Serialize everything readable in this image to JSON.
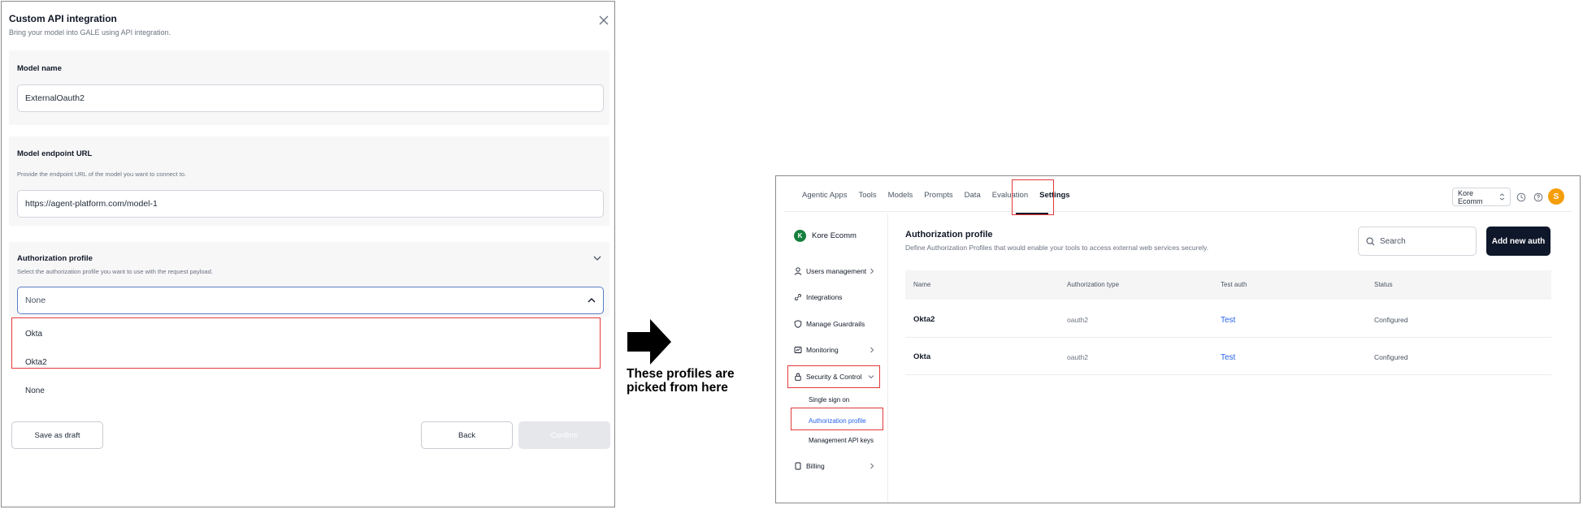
{
  "modal": {
    "title": "Custom API integration",
    "subtitle": "Bring your model into GALE using API integration.",
    "close_icon": "close-icon",
    "model_name": {
      "label": "Model name",
      "value": "ExternalOauth2"
    },
    "endpoint": {
      "label": "Model endpoint URL",
      "help": "Provide the endpoint URL of the model you want to connect to.",
      "value": "https://agent-platform.com/model-1"
    },
    "auth_profile": {
      "label": "Authorization profile",
      "help": "Select the authorization profile you want to use with the request payload.",
      "selected": "None",
      "options": [
        "Okta",
        "Okta2",
        "None"
      ]
    },
    "buttons": {
      "save_draft": "Save as draft",
      "back": "Back",
      "confirm": "Confirm"
    }
  },
  "annotation": {
    "text": "These profiles are picked from here",
    "highlight_color": "#e23a3a"
  },
  "app": {
    "nav_tabs": [
      "Agentic Apps",
      "Tools",
      "Models",
      "Prompts",
      "Data",
      "Evaluation",
      "Settings"
    ],
    "active_tab": "Settings",
    "workspace": "Kore Ecomm",
    "avatar_initial": "S",
    "sidebar": {
      "brand": "Kore Ecomm",
      "brand_initial": "K",
      "items": [
        {
          "label": "Users management",
          "icon": "user-icon",
          "has_chevron": true
        },
        {
          "label": "Integrations",
          "icon": "link-icon",
          "has_chevron": false
        },
        {
          "label": "Manage Guardrails",
          "icon": "shield-icon",
          "has_chevron": false
        },
        {
          "label": "Monitoring",
          "icon": "monitor-icon",
          "has_chevron": true
        },
        {
          "label": "Security & Control",
          "icon": "lock-icon",
          "has_chevron": true
        },
        {
          "label": "Billing",
          "icon": "billing-icon",
          "has_chevron": true
        }
      ],
      "sub_items": [
        "Single sign on",
        "Authorization profile",
        "Management API keys"
      ],
      "active_sub_item": "Authorization profile"
    },
    "content": {
      "title": "Authorization profile",
      "subtitle": "Define Authorization Profiles that would enable your tools to access external web services securely.",
      "search_placeholder": "Search",
      "add_button": "Add new auth",
      "columns": [
        "Name",
        "Authorization type",
        "Test auth",
        "Status"
      ],
      "rows": [
        {
          "name": "Okta2",
          "type": "oauth2",
          "test": "Test",
          "status": "Configured"
        },
        {
          "name": "Okta",
          "type": "oauth2",
          "test": "Test",
          "status": "Configured"
        }
      ]
    }
  }
}
